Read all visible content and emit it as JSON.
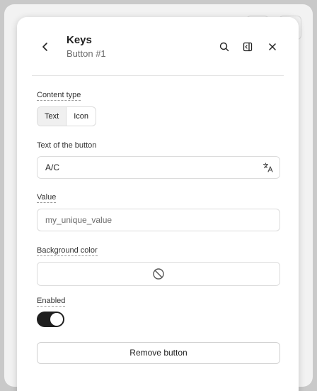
{
  "header": {
    "title": "Keys",
    "subtitle": "Button #1"
  },
  "content_type": {
    "label": "Content type",
    "options": [
      "Text",
      "Icon"
    ],
    "selected": "Text"
  },
  "button_text": {
    "label": "Text of the button",
    "value": "A/C"
  },
  "value_field": {
    "label": "Value",
    "placeholder": "my_unique_value"
  },
  "background_color": {
    "label": "Background color",
    "value_icon": "no-color-icon"
  },
  "enabled": {
    "label": "Enabled",
    "on": true
  },
  "remove_button": {
    "label": "Remove button"
  },
  "icons": {
    "back": "chevron-left-icon",
    "search": "search-icon",
    "panel": "panel-toggle-icon",
    "close": "close-icon",
    "translate": "translate-icon"
  },
  "colors": {
    "toggle_on": "#1f1f1f",
    "backdrop": "#c9c9c9"
  }
}
